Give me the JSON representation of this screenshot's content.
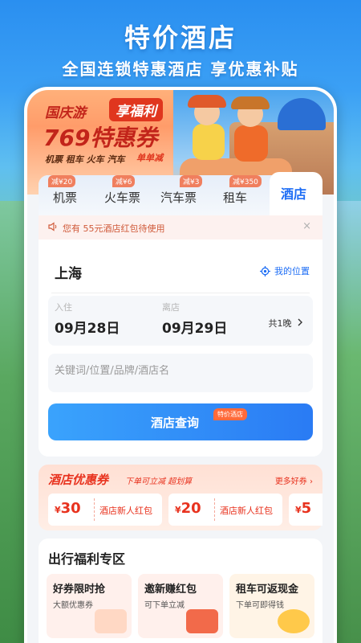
{
  "promo": {
    "title": "特价酒店",
    "subtitle": "全国连锁特惠酒店 享优惠补贴"
  },
  "banner": {
    "line1": "国庆游",
    "line1_tag": "享福利",
    "line2": "769特惠券",
    "line3": "机票 租车 火车 汽车",
    "line3_tag": "单单减"
  },
  "tabs": [
    {
      "label": "机票",
      "badge": "减¥20"
    },
    {
      "label": "火车票",
      "badge": "减¥6"
    },
    {
      "label": "汽车票",
      "badge": "减¥3"
    },
    {
      "label": "租车",
      "badge": "减¥350"
    },
    {
      "label": "酒店",
      "badge": ""
    }
  ],
  "notice": {
    "text": "您有 55元酒店红包待使用",
    "close": "×"
  },
  "search": {
    "city": "上海",
    "my_location": "我的位置",
    "checkin_label": "入住",
    "checkin_date": "09月28日",
    "checkout_label": "离店",
    "checkout_date": "09月29日",
    "nights": "共1晚",
    "keyword_placeholder": "关键词/位置/品牌/酒店名",
    "button_label": "酒店查询",
    "button_tag": "特价酒店"
  },
  "coupons": {
    "title": "酒店优惠券",
    "subtitle": "下单可立减 超划算",
    "more": "更多好券",
    "items": [
      {
        "currency": "¥",
        "amount": "30",
        "label": "酒店新人红包"
      },
      {
        "currency": "¥",
        "amount": "20",
        "label": "酒店新人红包"
      },
      {
        "currency": "¥",
        "amount": "5",
        "label": ""
      }
    ]
  },
  "welfare": {
    "title": "出行福利专区",
    "items": [
      {
        "name": "好券限时抢",
        "desc": "大额优惠券"
      },
      {
        "name": "邀新赚红包",
        "desc": "可下单立减"
      },
      {
        "name": "租车可返现金",
        "desc": "下单可即得钱"
      }
    ]
  },
  "colors": {
    "accent": "#1e6ef5",
    "promo_red": "#e8321e",
    "notice_text": "#d05a3a"
  }
}
